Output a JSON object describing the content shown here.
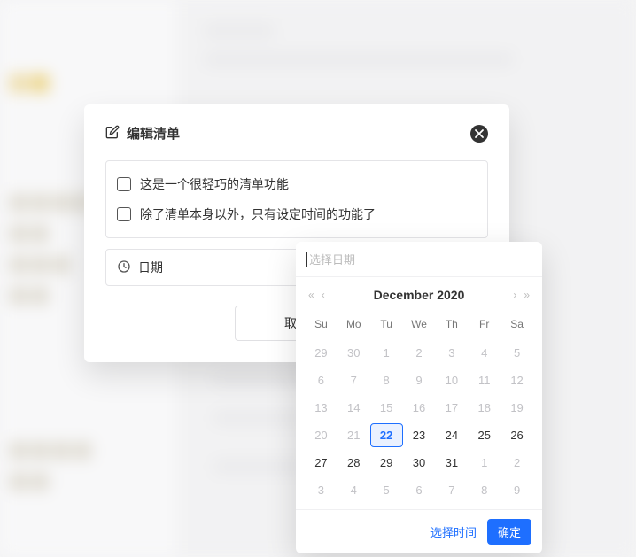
{
  "modal": {
    "title": "编辑清单",
    "items": [
      "这是一个很轻巧的清单功能",
      "除了清单本身以外，只有设定时间的功能了"
    ],
    "date_label": "日期",
    "cancel_label": "取消"
  },
  "datepicker": {
    "placeholder": "选择日期",
    "month_label": "December 2020",
    "dow": [
      "Su",
      "Mo",
      "Tu",
      "We",
      "Th",
      "Fr",
      "Sa"
    ],
    "weeks": [
      [
        {
          "d": 29,
          "o": true
        },
        {
          "d": 30,
          "o": true
        },
        {
          "d": 1,
          "o": true
        },
        {
          "d": 2,
          "o": true
        },
        {
          "d": 3,
          "o": true
        },
        {
          "d": 4,
          "o": true
        },
        {
          "d": 5,
          "o": true
        }
      ],
      [
        {
          "d": 6,
          "o": true
        },
        {
          "d": 7,
          "o": true
        },
        {
          "d": 8,
          "o": true
        },
        {
          "d": 9,
          "o": true
        },
        {
          "d": 10,
          "o": true
        },
        {
          "d": 11,
          "o": true
        },
        {
          "d": 12,
          "o": true
        }
      ],
      [
        {
          "d": 13,
          "o": true
        },
        {
          "d": 14,
          "o": true
        },
        {
          "d": 15,
          "o": true
        },
        {
          "d": 16,
          "o": true
        },
        {
          "d": 17,
          "o": true
        },
        {
          "d": 18,
          "o": true
        },
        {
          "d": 19,
          "o": true
        }
      ],
      [
        {
          "d": 20,
          "o": true
        },
        {
          "d": 21,
          "o": true
        },
        {
          "d": 22,
          "today": true
        },
        {
          "d": 23
        },
        {
          "d": 24
        },
        {
          "d": 25
        },
        {
          "d": 26
        }
      ],
      [
        {
          "d": 27
        },
        {
          "d": 28
        },
        {
          "d": 29
        },
        {
          "d": 30
        },
        {
          "d": 31
        },
        {
          "d": 1,
          "o": true
        },
        {
          "d": 2,
          "o": true
        }
      ],
      [
        {
          "d": 3,
          "o": true
        },
        {
          "d": 4,
          "o": true
        },
        {
          "d": 5,
          "o": true
        },
        {
          "d": 6,
          "o": true
        },
        {
          "d": 7,
          "o": true
        },
        {
          "d": 8,
          "o": true
        },
        {
          "d": 9,
          "o": true
        }
      ]
    ],
    "select_time_label": "选择时间",
    "ok_label": "确定"
  }
}
